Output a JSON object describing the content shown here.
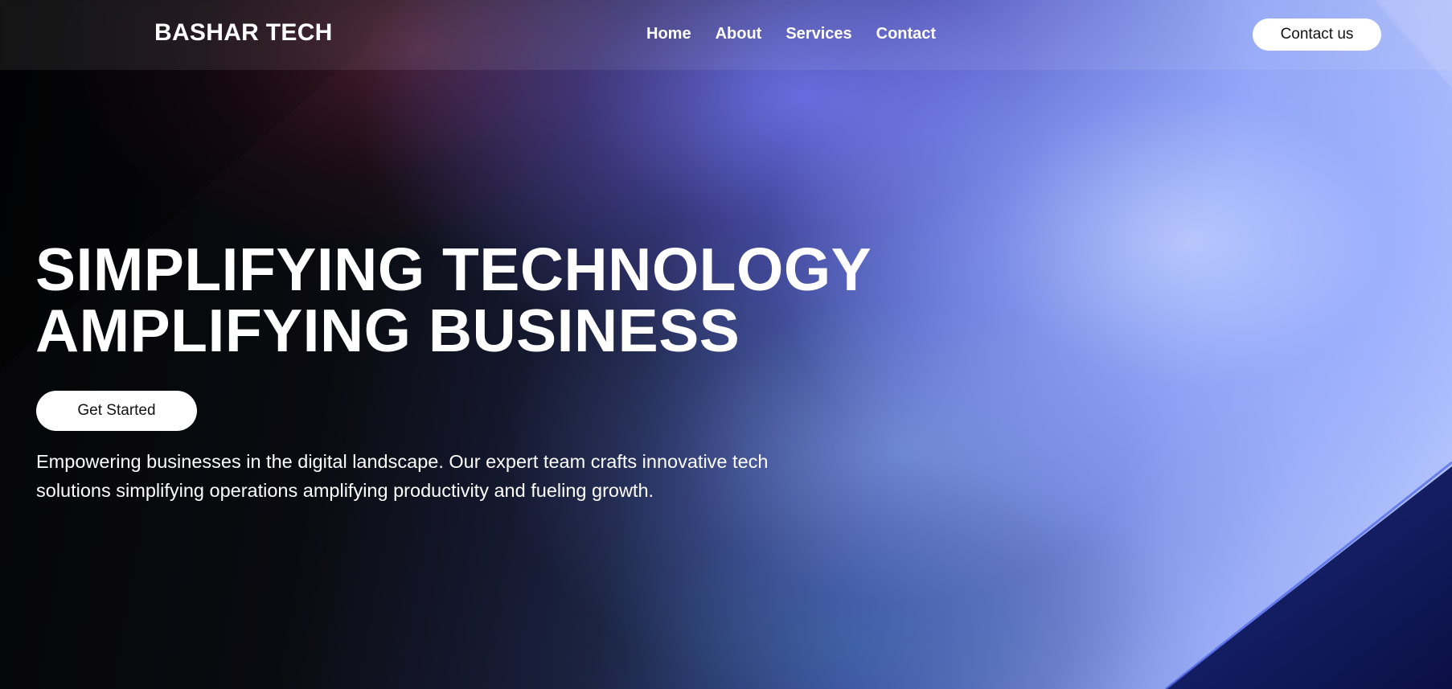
{
  "header": {
    "brand": "BASHAR TECH",
    "nav": [
      {
        "label": "Home"
      },
      {
        "label": "About"
      },
      {
        "label": "Services"
      },
      {
        "label": "Contact"
      }
    ],
    "contact_button": "Contact us"
  },
  "hero": {
    "title_line1": "SIMPLIFYING TECHNOLOGY",
    "title_line2": "AMPLIFYING BUSINESS",
    "cta_label": "Get Started",
    "description": "Empowering businesses in the digital landscape. Our expert team crafts innovative tech solutions simplifying operations amplifying productivity and fueling growth."
  },
  "colors": {
    "text": "#ffffff",
    "button_bg": "#ffffff",
    "button_text": "#111111",
    "accent_blue": "#6a78f0"
  }
}
